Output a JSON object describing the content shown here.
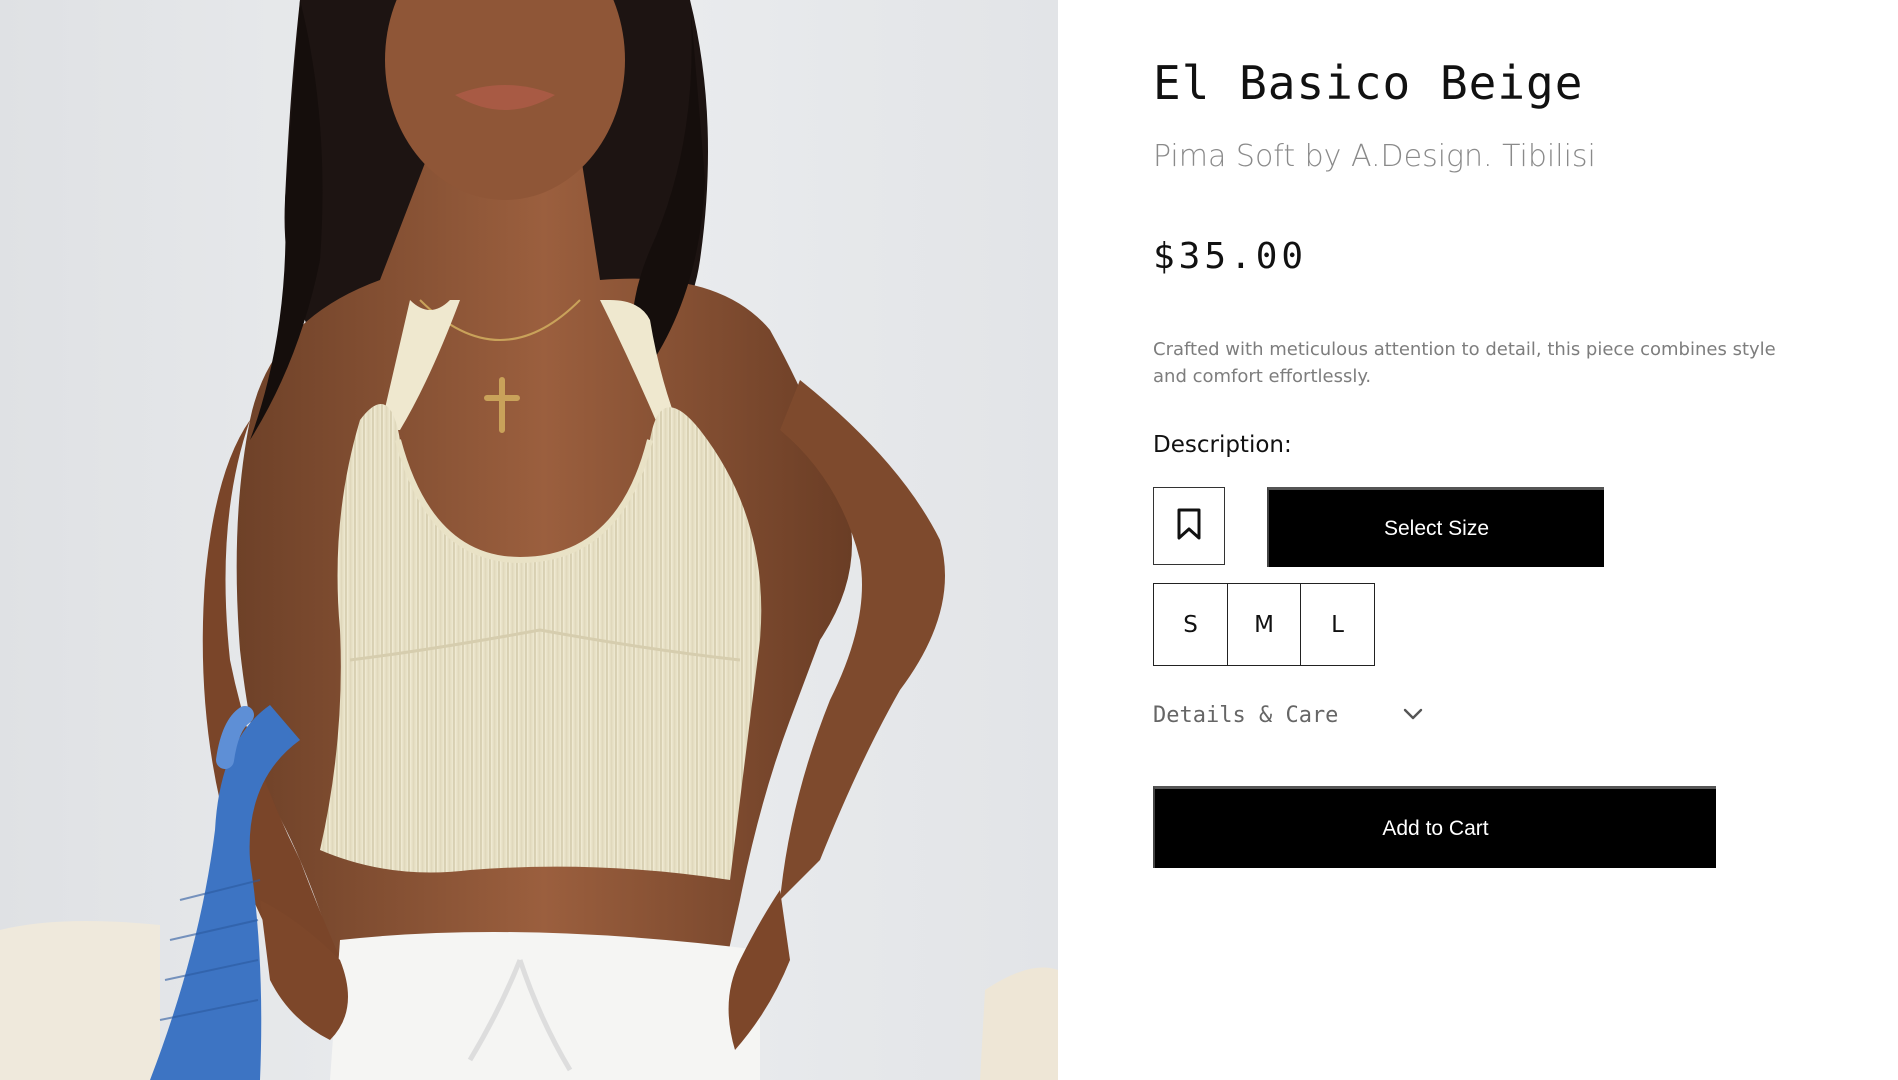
{
  "product": {
    "title": "El Basico Beige",
    "subtitle": "Pima Soft by A.Design. Tibilisi",
    "price": "$35.00",
    "blurb": "Crafted with meticulous attention to detail, this piece combines style and comfort effortlessly.",
    "description_label": "Description:",
    "image_alt": "Model wearing a beige ribbed knit halter crop top with white trousers"
  },
  "actions": {
    "bookmark_icon": "bookmark-icon",
    "select_size_label": "Select Size",
    "add_to_cart_label": "Add to Cart"
  },
  "sizes": [
    "S",
    "M",
    "L"
  ],
  "details_care": {
    "label": "Details & Care",
    "icon": "chevron-down-icon"
  },
  "colors": {
    "primary_button": "#000000",
    "button_text": "#ffffff",
    "subtitle_text": "#8a8a8a",
    "body_text": "#7d7d7d"
  }
}
